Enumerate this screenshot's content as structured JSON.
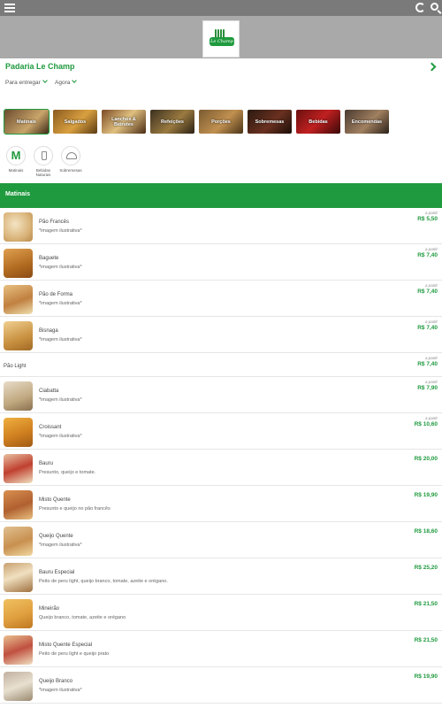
{
  "header": {
    "menu_icon": "hamburger-menu-icon",
    "refresh_icon": "refresh-icon",
    "search_icon": "search-icon",
    "logo_text": "Le Champ"
  },
  "store": {
    "name": "Padaria Le Champ",
    "delivery_option": "Para entregar",
    "time_option": "Agora"
  },
  "categories": [
    {
      "label": "Matinais",
      "active": true
    },
    {
      "label": "Salgados"
    },
    {
      "label": "Lanches & Beirutes"
    },
    {
      "label": "Refeições"
    },
    {
      "label": "Porções"
    },
    {
      "label": "Sobremesas"
    },
    {
      "label": "Bebidas"
    },
    {
      "label": "Encomendas"
    }
  ],
  "quick_links": [
    {
      "label": "Matinais",
      "icon": "m-letter-icon"
    },
    {
      "label": "Bebidas Naturais",
      "icon": "cup-icon"
    },
    {
      "label": "Sobremesas",
      "icon": "cloche-icon"
    }
  ],
  "section_title": "Matinais",
  "price_prefix": "a partir",
  "items": [
    {
      "name": "Pão Francês",
      "desc": "*imagem ilustrativa*",
      "price": "R$ 5,50",
      "from": true
    },
    {
      "name": "Baguete",
      "desc": "*imagem ilustrativa*",
      "price": "R$ 7,40",
      "from": true
    },
    {
      "name": "Pão de Forma",
      "desc": "*imagem ilustrativa*",
      "price": "R$ 7,40",
      "from": true
    },
    {
      "name": "Bisnaga",
      "desc": "*imagem ilustrativa*",
      "price": "R$ 7,40",
      "from": true
    },
    {
      "name": "Pão Light",
      "desc": "",
      "price": "R$ 7,40",
      "from": true,
      "noimg": true
    },
    {
      "name": "Ciabatta",
      "desc": "*imagem ilustrativa*",
      "price": "R$ 7,90",
      "from": true
    },
    {
      "name": "Croissant",
      "desc": "*imagem ilustrativa*",
      "price": "R$ 10,60",
      "from": true
    },
    {
      "name": "Bauru",
      "desc": "Presunto, queijo e tomate.",
      "price": "R$ 20,00",
      "from": false
    },
    {
      "name": "Misto Quente",
      "desc": "Presunto e queijo no pão francês",
      "price": "R$ 19,90",
      "from": false
    },
    {
      "name": "Queijo Quente",
      "desc": "*imagem ilustrativa*",
      "price": "R$ 18,60",
      "from": false
    },
    {
      "name": "Bauru Especial",
      "desc": "Peito de peru light, queijo branco, tomate, azeite e orégano.",
      "price": "R$ 25,20",
      "from": false
    },
    {
      "name": "Mineirão",
      "desc": "Queijo branco, tomate, azeite e orégano",
      "price": "R$ 21,50",
      "from": false
    },
    {
      "name": "Misto Quente Especial",
      "desc": "Peito de peru light e queijo prato",
      "price": "R$ 21,50",
      "from": false
    },
    {
      "name": "Queijo Branco",
      "desc": "*imagem ilustrativa*",
      "price": "R$ 19,90",
      "from": false
    }
  ],
  "colors": {
    "brand_green": "#1f9a3e",
    "topbar_gray": "#7a7a7a",
    "banner_gray": "#a9a9a9"
  }
}
